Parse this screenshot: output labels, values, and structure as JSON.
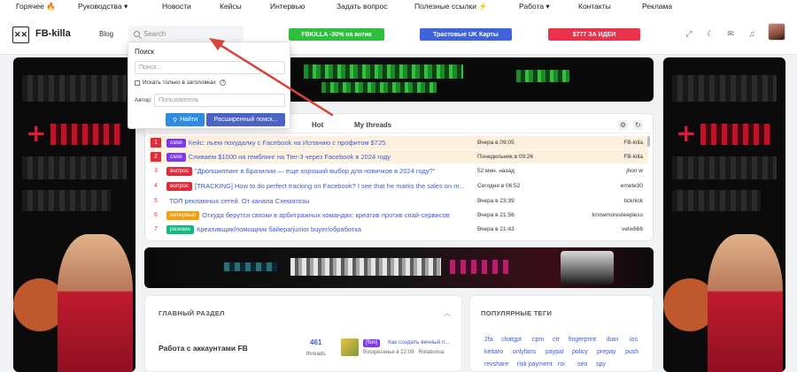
{
  "topnav": {
    "items": [
      "Горячее 🔥",
      "Руководства ▾",
      "Новости",
      "Кейсы",
      "Интервью",
      "Задать вопрос",
      "Полезные ссылки ⚡",
      "Работа ▾",
      "Контакты",
      "Реклама"
    ]
  },
  "header": {
    "logo_mark": "✕✕",
    "logo_text": "FB-killa",
    "blog": "Blog",
    "search_placeholder": "Search",
    "promos": [
      {
        "label": "FBKILLA -30% на антик",
        "color": "#2fbf3f"
      },
      {
        "label": "Трастовые UK Карты",
        "color": "#3f63d8"
      },
      {
        "label": "$777 ЗА ИДЕИ",
        "color": "#e8334a"
      }
    ],
    "icons": [
      "expand-icon",
      "moon-icon",
      "mail-icon",
      "bell-icon"
    ]
  },
  "search_popup": {
    "title": "Поиск",
    "query_placeholder": "Поиск...",
    "titles_only_label": "Искать только в заголовках",
    "author_label": "Автор:",
    "author_placeholder": "Пользователь",
    "find_button": "Найти",
    "advanced_button": "Расширенный поиск..."
  },
  "threads": {
    "tabs": [
      "Hot",
      "My threads"
    ],
    "rows": [
      {
        "num": "1",
        "boxed": true,
        "highlight": true,
        "badge": "case",
        "badge_color": "#7c3aed",
        "title": "Кейс: льем похудалку с Facebook на Испанию с профитом $725",
        "time": "Вчера в 09:05",
        "author": "FB-killa"
      },
      {
        "num": "2",
        "boxed": true,
        "highlight": true,
        "badge": "case",
        "badge_color": "#7c3aed",
        "title": "Сливаем $1000 на гемблинг на Tier-3 через Facebook в 2024 году",
        "time": "Понедельник в 09:26",
        "author": "FB-killa"
      },
      {
        "num": "3",
        "boxed": false,
        "highlight": false,
        "badge": "вопрос",
        "badge_color": "#e02b3b",
        "title": "\"Дропшиппинг в Бразилии — еще хороший выбор для новичков в 2024 году?\"",
        "time": "52 мин. назад",
        "author": "jhon w"
      },
      {
        "num": "4",
        "boxed": false,
        "highlight": false,
        "badge": "вопрос",
        "badge_color": "#e02b3b",
        "title": "[TRACKING] How to do perfect tracking on Facebook? I see that he marks the sales on m...",
        "time": "Сегодня в 06:52",
        "author": "emete30"
      },
      {
        "num": "5",
        "boxed": false,
        "highlight": false,
        "badge": "",
        "badge_color": "",
        "title": "ТОП рекламных сетей. От канала Схематозы",
        "time": "Вчера в 23:39",
        "author": "ticknick"
      },
      {
        "num": "6",
        "boxed": false,
        "highlight": false,
        "badge": "интервью",
        "badge_color": "#f59e0b",
        "title": "Откуда берутся связки в арбитражных командах: креатив против спай-сервисов",
        "time": "Вчера в 21:56",
        "author": "knowmoresleepless"
      },
      {
        "num": "7",
        "boxed": false,
        "highlight": false,
        "badge": "резюме",
        "badge_color": "#10b981",
        "title": "Креативщик/помощник байера/junior buyer/обработка",
        "time": "Вчера в 21:43",
        "author": "velix666"
      }
    ]
  },
  "main_section": {
    "title": "ГЛАВНЫЙ РАЗДЕЛ",
    "forum_name": "Работа с аккаунтами FB",
    "count": "461",
    "count_label": "threads",
    "last_prefix": "[fbm]",
    "last_title": "Как создать вечный п...",
    "last_meta": "Воскресенье в 22:09 · Rotationsa"
  },
  "tags_section": {
    "title": "ПОПУЛЯРНЫЕ ТЕГИ",
    "tags": [
      "2fa",
      "chatgpt",
      "cpm",
      "ctr",
      "fingerprint",
      "iban",
      "ios",
      "keitaro",
      "onlyfans",
      "paypal",
      "policy",
      "prepay",
      "push",
      "revshare",
      "risk payment",
      "roi",
      "seo",
      "spy"
    ]
  }
}
